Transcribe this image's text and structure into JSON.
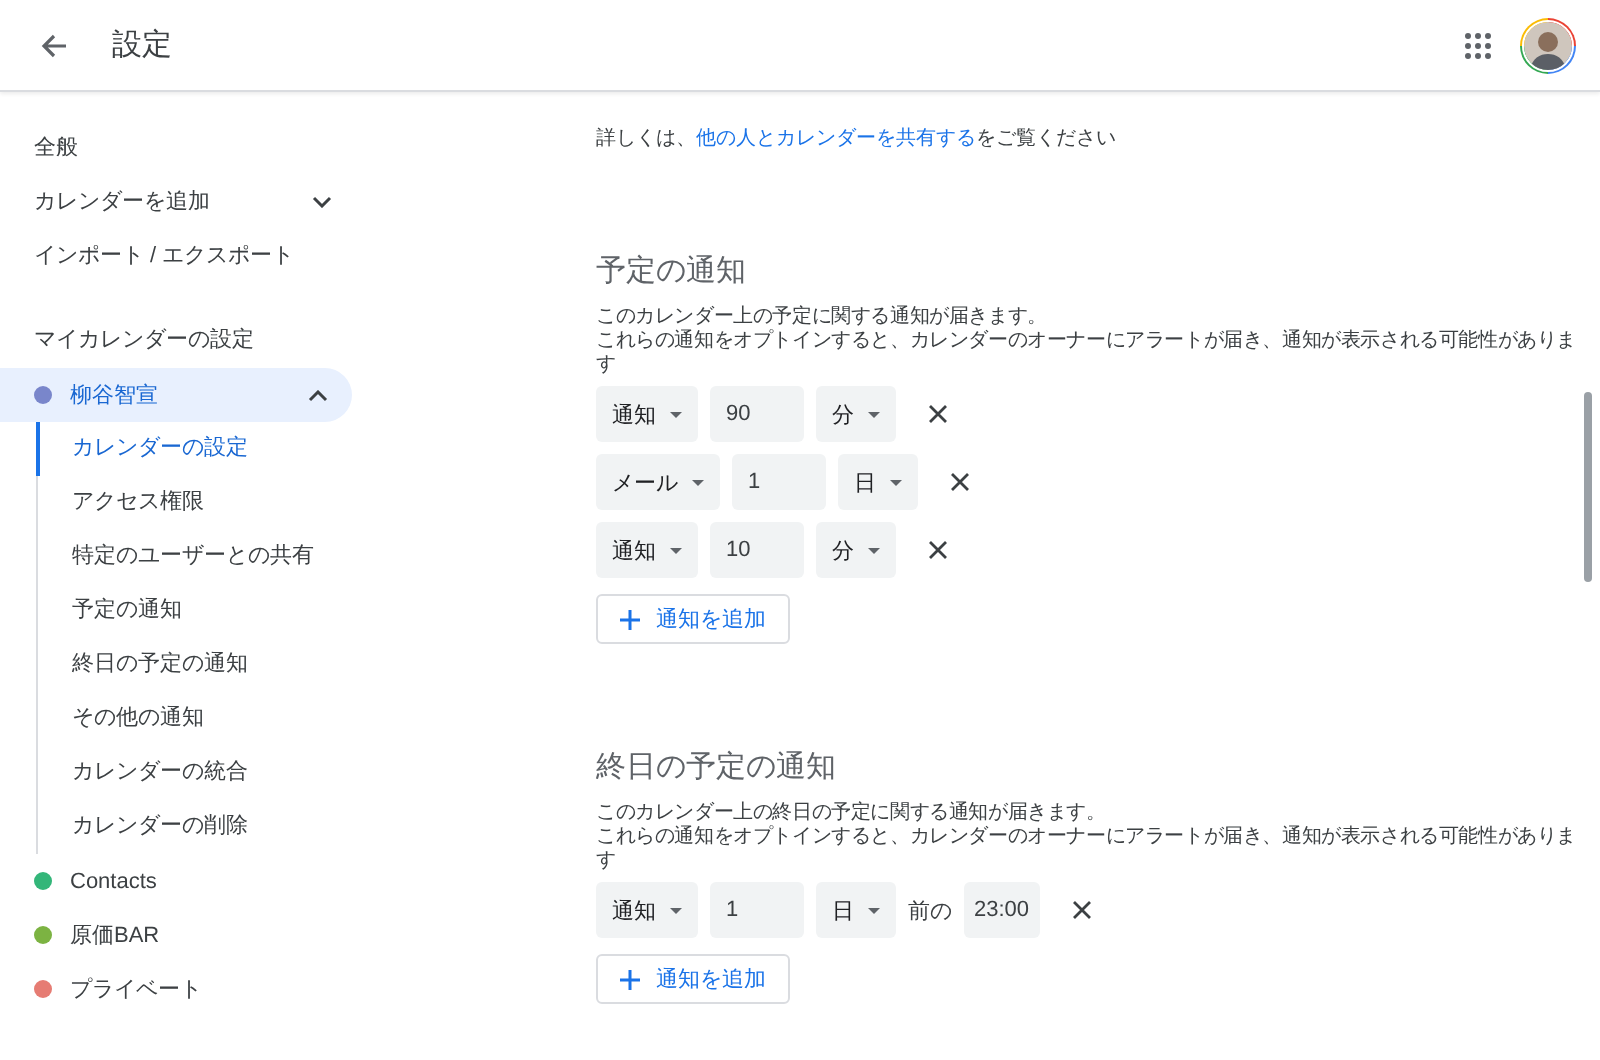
{
  "header": {
    "title": "設定"
  },
  "sidebar": {
    "items": [
      {
        "label": "全般"
      },
      {
        "label": "カレンダーを追加",
        "expanded": false
      },
      {
        "label": "インポート / エクスポート"
      }
    ],
    "section_title": "マイカレンダーの設定",
    "calendars": [
      {
        "name": "柳谷智宣",
        "color": "#7986cb",
        "selected": true,
        "expanded": true,
        "children": [
          {
            "label": "カレンダーの設定",
            "selected": true
          },
          {
            "label": "アクセス権限",
            "selected": false
          },
          {
            "label": "特定のユーザーとの共有",
            "selected": false
          },
          {
            "label": "予定の通知",
            "selected": false
          },
          {
            "label": "終日の予定の通知",
            "selected": false
          },
          {
            "label": "その他の通知",
            "selected": false
          },
          {
            "label": "カレンダーの統合",
            "selected": false
          },
          {
            "label": "カレンダーの削除",
            "selected": false
          }
        ]
      },
      {
        "name": "Contacts",
        "color": "#33b679",
        "selected": false
      },
      {
        "name": "原価BAR",
        "color": "#7cb342",
        "selected": false
      },
      {
        "name": "プライベート",
        "color": "#e67c73",
        "selected": false
      }
    ]
  },
  "content": {
    "info": {
      "before": "詳しくは、",
      "link": "他の人とカレンダーを共有する",
      "after": "をご覧ください"
    },
    "sections": [
      {
        "title": "予定の通知",
        "lines": [
          "このカレンダー上の予定に関する通知が届きます。",
          "これらの通知をオプトインすると、カレンダーのオーナーにアラートが届き、通知が表示される可能性があります"
        ],
        "rows": [
          {
            "method": "通知",
            "amount": "90",
            "unit": "分"
          },
          {
            "method": "メール",
            "amount": "1",
            "unit": "日"
          },
          {
            "method": "通知",
            "amount": "10",
            "unit": "分"
          }
        ],
        "add_button": "通知を追加"
      },
      {
        "title": "終日の予定の通知",
        "lines": [
          "このカレンダー上の終日の予定に関する通知が届きます。",
          "これらの通知をオプトインすると、カレンダーのオーナーにアラートが届き、通知が表示される可能性があります"
        ],
        "rows": [
          {
            "method": "通知",
            "amount": "1",
            "unit": "日",
            "suffix": "前の",
            "time": "23:00"
          }
        ],
        "add_button": "通知を追加"
      }
    ]
  }
}
